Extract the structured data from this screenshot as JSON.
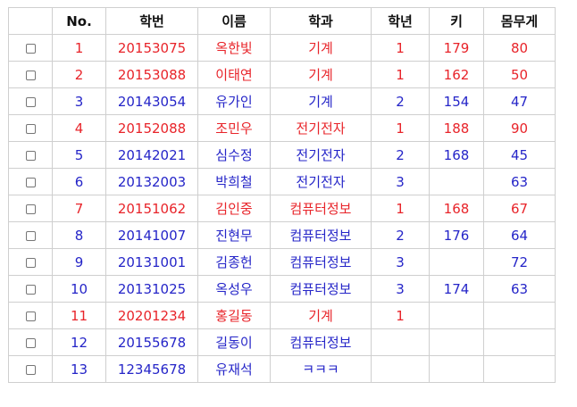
{
  "table": {
    "headers": [
      "",
      "No.",
      "학번",
      "이름",
      "학과",
      "학년",
      "키",
      "몸무게"
    ],
    "rows": [
      {
        "no": "1",
        "id": "20153075",
        "name": "옥한빛",
        "dept": "기계",
        "year": "1",
        "height": "179",
        "weight": "80",
        "color": "red"
      },
      {
        "no": "2",
        "id": "20153088",
        "name": "이태연",
        "dept": "기계",
        "year": "1",
        "height": "162",
        "weight": "50",
        "color": "red"
      },
      {
        "no": "3",
        "id": "20143054",
        "name": "유가인",
        "dept": "기계",
        "year": "2",
        "height": "154",
        "weight": "47",
        "color": "blue"
      },
      {
        "no": "4",
        "id": "20152088",
        "name": "조민우",
        "dept": "전기전자",
        "year": "1",
        "height": "188",
        "weight": "90",
        "color": "red"
      },
      {
        "no": "5",
        "id": "20142021",
        "name": "심수정",
        "dept": "전기전자",
        "year": "2",
        "height": "168",
        "weight": "45",
        "color": "blue"
      },
      {
        "no": "6",
        "id": "20132003",
        "name": "박희철",
        "dept": "전기전자",
        "year": "3",
        "height": "",
        "weight": "63",
        "color": "blue"
      },
      {
        "no": "7",
        "id": "20151062",
        "name": "김인중",
        "dept": "컴퓨터정보",
        "year": "1",
        "height": "168",
        "weight": "67",
        "color": "red"
      },
      {
        "no": "8",
        "id": "20141007",
        "name": "진현무",
        "dept": "컴퓨터정보",
        "year": "2",
        "height": "176",
        "weight": "64",
        "color": "blue"
      },
      {
        "no": "9",
        "id": "20131001",
        "name": "김종헌",
        "dept": "컴퓨터정보",
        "year": "3",
        "height": "",
        "weight": "72",
        "color": "blue"
      },
      {
        "no": "10",
        "id": "20131025",
        "name": "옥성우",
        "dept": "컴퓨터정보",
        "year": "3",
        "height": "174",
        "weight": "63",
        "color": "blue"
      },
      {
        "no": "11",
        "id": "20201234",
        "name": "홍길동",
        "dept": "기계",
        "year": "1",
        "height": "",
        "weight": "",
        "color": "red"
      },
      {
        "no": "12",
        "id": "20155678",
        "name": "길동이",
        "dept": "컴퓨터정보",
        "year": "",
        "height": "",
        "weight": "",
        "color": "blue"
      },
      {
        "no": "13",
        "id": "12345678",
        "name": "유재석",
        "dept": "ㅋㅋㅋ",
        "year": "",
        "height": "",
        "weight": "",
        "color": "blue"
      }
    ]
  },
  "colors": {
    "first_year": "#e8242a",
    "other_year": "#2525c8",
    "border": "#cfcfcf"
  }
}
